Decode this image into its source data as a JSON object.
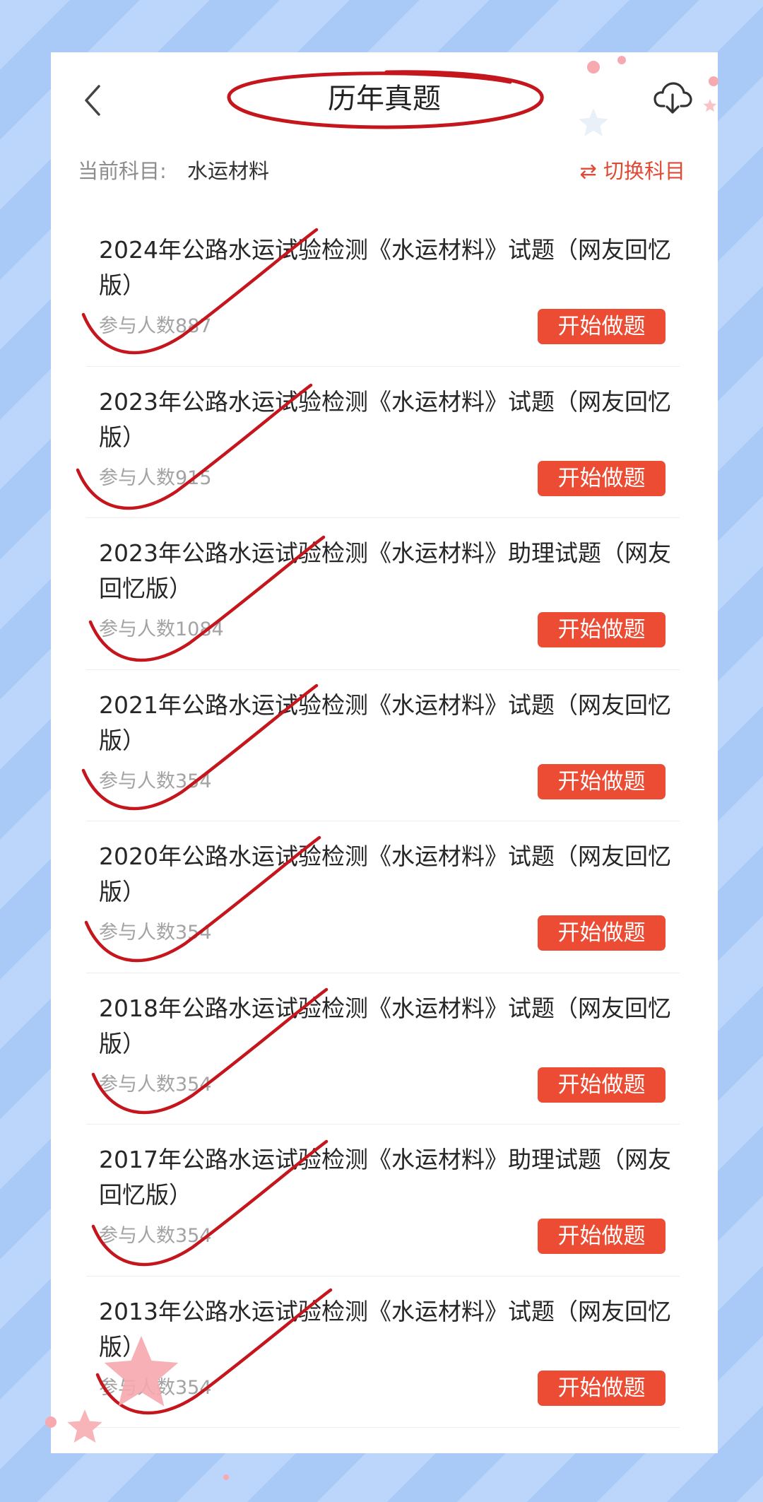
{
  "header": {
    "title": "历年真题"
  },
  "subject": {
    "label": "当前科目:",
    "value": "水运材料",
    "switch_label": "⇄ 切换科目"
  },
  "papers": [
    {
      "title": "2024年公路水运试验检测《水运材料》试题（网友回忆版）",
      "count": "参与人数887",
      "button": "开始做题"
    },
    {
      "title": "2023年公路水运试验检测《水运材料》试题（网友回忆版）",
      "count": "参与人数915",
      "button": "开始做题"
    },
    {
      "title": "2023年公路水运试验检测《水运材料》助理试题（网友回忆版）",
      "count": "参与人数1084",
      "button": "开始做题"
    },
    {
      "title": "2021年公路水运试验检测《水运材料》试题（网友回忆版）",
      "count": "参与人数354",
      "button": "开始做题"
    },
    {
      "title": "2020年公路水运试验检测《水运材料》试题（网友回忆版）",
      "count": "参与人数354",
      "button": "开始做题"
    },
    {
      "title": "2018年公路水运试验检测《水运材料》试题（网友回忆版）",
      "count": "参与人数354",
      "button": "开始做题"
    },
    {
      "title": "2017年公路水运试验检测《水运材料》助理试题（网友回忆版）",
      "count": "参与人数354",
      "button": "开始做题"
    },
    {
      "title": "2013年公路水运试验检测《水运材料》试题（网友回忆版）",
      "count": "参与人数354",
      "button": "开始做题"
    }
  ],
  "colors": {
    "accent": "#ec4c33",
    "annotation": "#c4161c",
    "background": "#bcd6fb"
  },
  "icons": {
    "back": "chevron-left-icon",
    "download": "cloud-download-icon",
    "annotation": "checkmark-icon",
    "decor": "star-icon"
  }
}
